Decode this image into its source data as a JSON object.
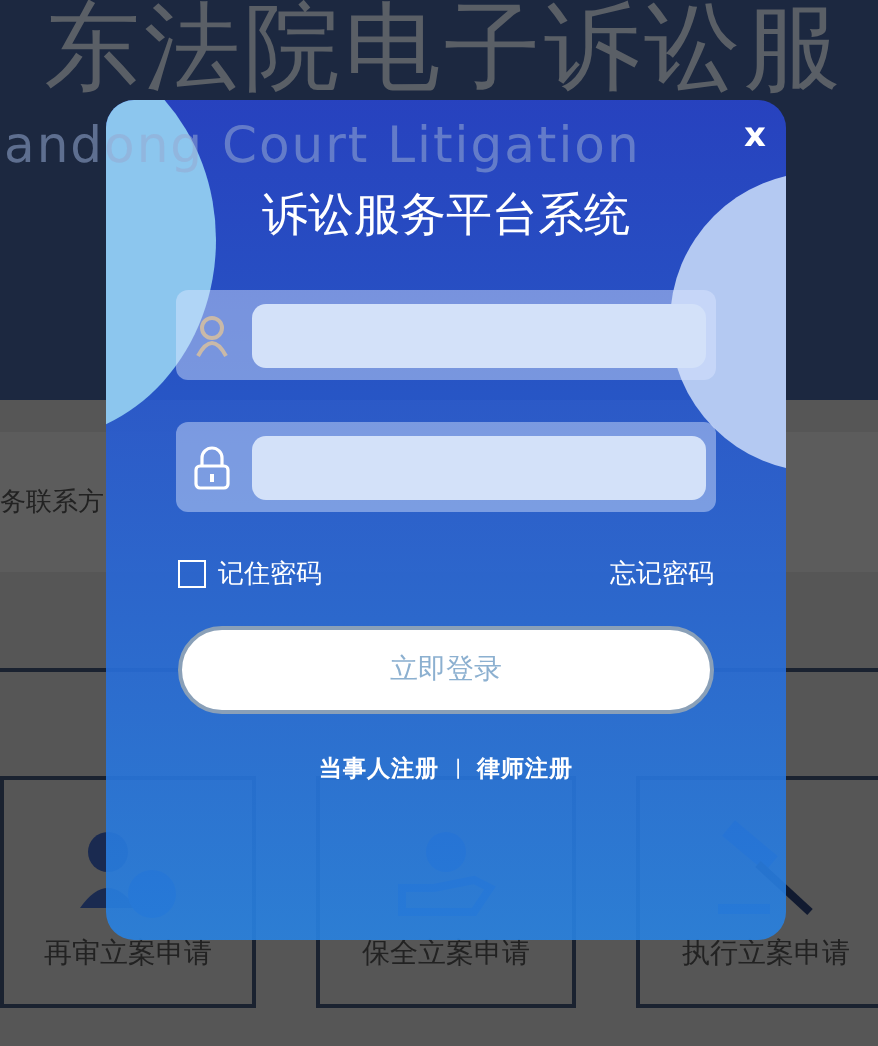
{
  "background": {
    "title": "东法院电子诉讼服",
    "subtitle": "andong Court Litigation",
    "contact_label": "务联系方",
    "cards": [
      {
        "label": "再审立案申请",
        "kind": "judge"
      },
      {
        "label": "保全立案申请",
        "kind": "hand"
      },
      {
        "label": "执行立案申请",
        "kind": "gavel"
      }
    ]
  },
  "dialog": {
    "close": "x",
    "title": "诉讼服务平台系统",
    "fields": [
      {
        "kind": "user"
      },
      {
        "kind": "password"
      }
    ],
    "remember": {
      "label": "记住密码",
      "checked": false
    },
    "forgot": "忘记密码",
    "submit": "立即登录",
    "links": [
      {
        "label": "当事人注册"
      },
      {
        "label": "律师注册"
      }
    ],
    "separator": "|"
  }
}
